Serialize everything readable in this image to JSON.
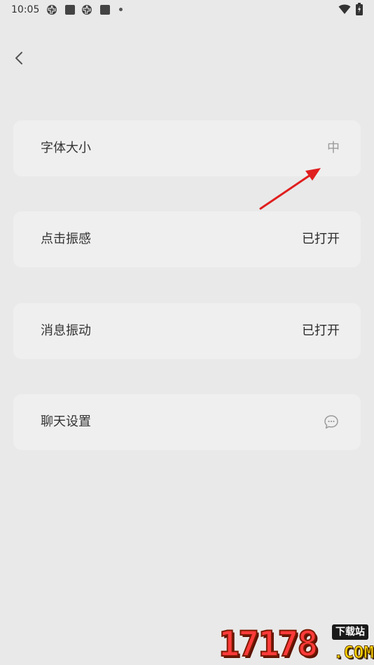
{
  "status_bar": {
    "time": "10:05"
  },
  "header": {
    "back_icon": "chevron-left-icon"
  },
  "settings": [
    {
      "label": "字体大小",
      "value": "中"
    },
    {
      "label": "点击振感",
      "value": "已打开"
    },
    {
      "label": "消息振动",
      "value": "已打开"
    },
    {
      "label": "聊天设置",
      "icon": "chat-bubble-icon"
    }
  ],
  "annotation": {
    "color": "#e01f1f",
    "points_to": "字体大小"
  },
  "watermark": {
    "digits": "17178",
    "tag": "下载站",
    "domain": ".COM"
  }
}
